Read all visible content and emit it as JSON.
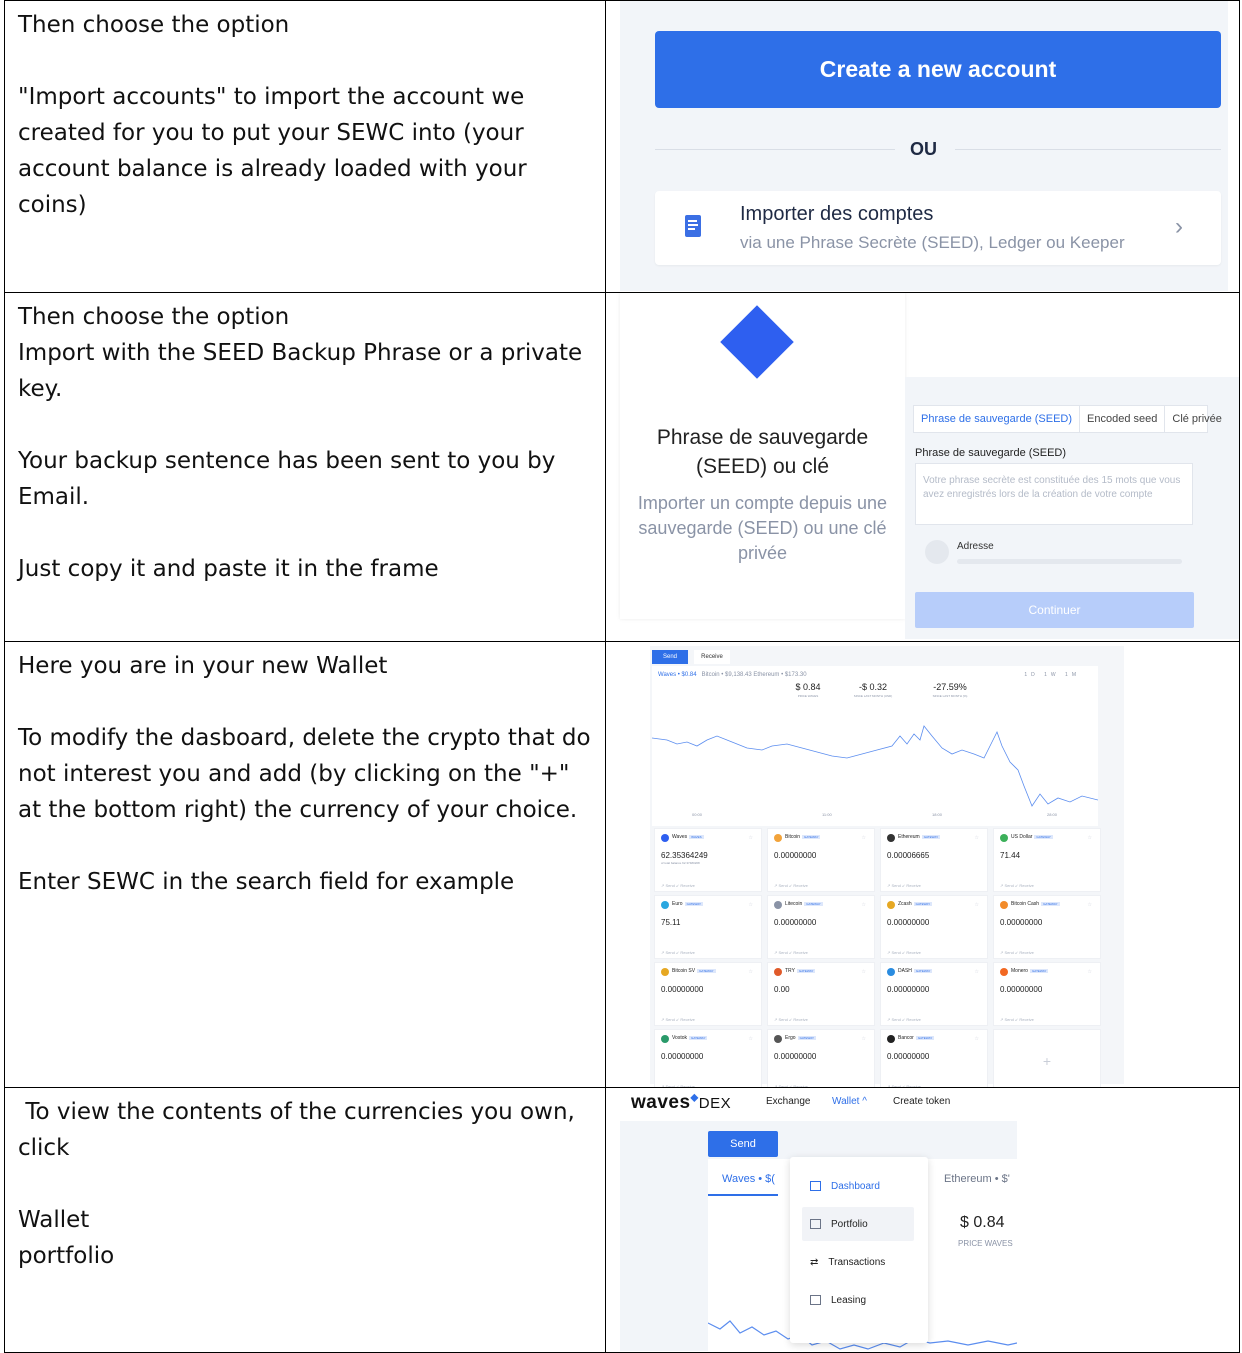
{
  "rows": [
    {
      "text": "Then choose the option\n\n\"Import accounts\" to import the account we created for you to put your SEWC into (your account balance is already loaded with your coins)",
      "panel": {
        "create_button": "Create a new account",
        "separator": "OU",
        "import_title": "Importer des comptes",
        "import_subtitle": "via une Phrase Secrète (SEED), Ledger ou Keeper",
        "import_icon": "document-icon",
        "chevron_icon": "chevron-right-icon"
      }
    },
    {
      "text": "Then choose the option\nImport with the SEED Backup Phrase or a private key.\n\nYour backup sentence has been sent to you by Email.\n\nJust copy it and paste it in the frame",
      "panel": {
        "title": "Phrase de sauvegarde (SEED) ou clé",
        "subtitle": "Importer un compte depuis une sauvegarde (SEED) ou une clé privée",
        "tabs": [
          "Phrase de sauvegarde (SEED)",
          "Encoded seed",
          "Clé privée"
        ],
        "field_label": "Phrase de sauvegarde (SEED)",
        "textarea_placeholder": "Votre phrase secrète est constituée des 15 mots que vous avez enregistrés lors de la création de votre compte",
        "address_label": "Adresse",
        "continue_button": "Continuer"
      }
    },
    {
      "text": "Here you are in your new Wallet\n\nTo modify the dasboard, delete the crypto that do not interest you and add (by clicking on the \"+\" at the bottom right) the currency of your choice.\n\nEnter SEWC in the search field for example",
      "panel": {
        "send": "Send",
        "receive": "Receive",
        "pair_active": "Waves • $0.84",
        "pairs_other": "Bitcoin • $9,138.43    Ethereum • $173.30",
        "periods": "1D 1W 1M",
        "stats": [
          {
            "value": "$ 0.84",
            "label": "PRICE WAVES"
          },
          {
            "value": "-$ 0.32",
            "label": "SINCE LAST MONTH (USD)"
          },
          {
            "value": "-27.59%",
            "label": "SINCE LAST MONTH (%)"
          }
        ],
        "times": [
          "00:00",
          "11:00",
          "18:00",
          "28:00"
        ],
        "card_actions": "↗ Send   ↙ Receive",
        "cards": [
          {
            "name": "Waves",
            "badge": "WAVES",
            "value": "62.35364249",
            "sub": "of total balance 62.37480208",
            "color": "#2e5ff0"
          },
          {
            "name": "Bitcoin",
            "badge": "GATEWAY",
            "value": "0.00000000",
            "sub": "",
            "color": "#f2a33a"
          },
          {
            "name": "Ethereum",
            "badge": "GATEWAY",
            "value": "0.00006665",
            "sub": "",
            "color": "#333333"
          },
          {
            "name": "US Dollar",
            "badge": "GATEWAY",
            "value": "71.44",
            "sub": "",
            "color": "#3cb05a"
          },
          {
            "name": "Euro",
            "badge": "GATEWAY",
            "value": "75.11",
            "sub": "",
            "color": "#2aa7e0"
          },
          {
            "name": "Litecoin",
            "badge": "GATEWAY",
            "value": "0.00000000",
            "sub": "",
            "color": "#8a93a6"
          },
          {
            "name": "Zcash",
            "badge": "GATEWAY",
            "value": "0.00000000",
            "sub": "",
            "color": "#e6a823"
          },
          {
            "name": "Bitcoin Cash",
            "badge": "GATEWAY",
            "value": "0.00000000",
            "sub": "",
            "color": "#f28b2a"
          },
          {
            "name": "Bitcoin SV",
            "badge": "GATEWAY",
            "value": "0.00000000",
            "sub": "",
            "color": "#e6a823"
          },
          {
            "name": "TRY",
            "badge": "GATEWAY",
            "value": "0.00",
            "sub": "",
            "color": "#e05a2a"
          },
          {
            "name": "DASH",
            "badge": "GATEWAY",
            "value": "0.00000000",
            "sub": "",
            "color": "#2a8ce0"
          },
          {
            "name": "Monero",
            "badge": "GATEWAY",
            "value": "0.00000000",
            "sub": "",
            "color": "#f26822"
          },
          {
            "name": "Vostok",
            "badge": "GATEWAY",
            "value": "0.00000000",
            "sub": "",
            "color": "#2a9a6a"
          },
          {
            "name": "Ergo",
            "badge": "GATEWAY",
            "value": "0.00000000",
            "sub": "",
            "color": "#555555"
          },
          {
            "name": "Bancor",
            "badge": "GATEWAY",
            "value": "0.00000000",
            "sub": "",
            "color": "#222222"
          }
        ],
        "add_symbol": "+"
      }
    },
    {
      "text": " To view the contents of the currencies you own, click\n\nWallet\nportfolio",
      "panel": {
        "logo": "waves",
        "logo_suffix": "DEX",
        "nav": [
          "Exchange",
          "Wallet ^",
          "Create token"
        ],
        "send": "Send",
        "tab_active": "Waves • $(",
        "tab_other": "Ethereum • $'",
        "price": "$ 0.84",
        "price_label": "PRICE WAVES",
        "menu": [
          "Dashboard",
          "Portfolio",
          "Transactions",
          "Leasing"
        ]
      }
    }
  ]
}
